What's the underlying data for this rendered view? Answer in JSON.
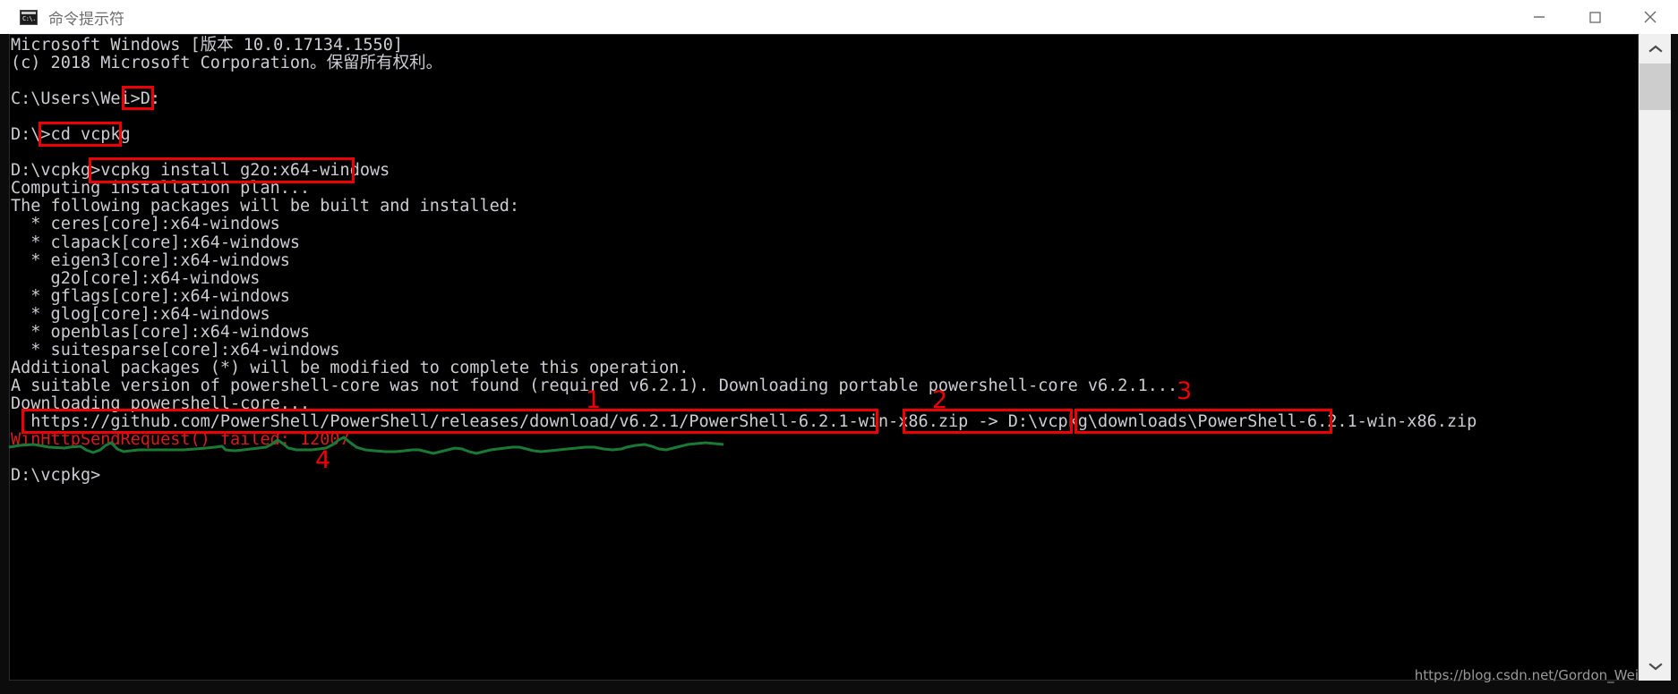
{
  "window": {
    "title": "命令提示符",
    "icon": "command-prompt-icon",
    "icon_text": "C:\\.",
    "controls": {
      "minimize": "minimize-icon",
      "maximize": "maximize-icon",
      "close": "close-icon"
    }
  },
  "colors": {
    "console_bg": "#000000",
    "console_fg": "#ccccd2",
    "error_fg": "#d81c1c",
    "annotation_red": "#ee0000",
    "annotation_green": "#1a7a35",
    "titlebar_bg": "#ffffff",
    "title_fg": "#6e6e6e"
  },
  "console": {
    "lines": [
      {
        "text": "Microsoft Windows [版本 10.0.17134.1550]",
        "error": false
      },
      {
        "text": "(c) 2018 Microsoft Corporation。保留所有权利。",
        "error": false
      },
      {
        "text": "",
        "error": false
      },
      {
        "text": "C:\\Users\\Wei>D:",
        "error": false
      },
      {
        "text": "",
        "error": false
      },
      {
        "text": "D:\\>cd vcpkg",
        "error": false
      },
      {
        "text": "",
        "error": false
      },
      {
        "text": "D:\\vcpkg>vcpkg install g2o:x64-windows",
        "error": false
      },
      {
        "text": "Computing installation plan...",
        "error": false
      },
      {
        "text": "The following packages will be built and installed:",
        "error": false
      },
      {
        "text": "  * ceres[core]:x64-windows",
        "error": false
      },
      {
        "text": "  * clapack[core]:x64-windows",
        "error": false
      },
      {
        "text": "  * eigen3[core]:x64-windows",
        "error": false
      },
      {
        "text": "    g2o[core]:x64-windows",
        "error": false
      },
      {
        "text": "  * gflags[core]:x64-windows",
        "error": false
      },
      {
        "text": "  * glog[core]:x64-windows",
        "error": false
      },
      {
        "text": "  * openblas[core]:x64-windows",
        "error": false
      },
      {
        "text": "  * suitesparse[core]:x64-windows",
        "error": false
      },
      {
        "text": "Additional packages (*) will be modified to complete this operation.",
        "error": false
      },
      {
        "text": "A suitable version of powershell-core was not found (required v6.2.1). Downloading portable powershell-core v6.2.1...",
        "error": false
      },
      {
        "text": "Downloading powershell-core...",
        "error": false
      },
      {
        "text": "  https://github.com/PowerShell/PowerShell/releases/download/v6.2.1/PowerShell-6.2.1-win-x86.zip -> D:\\vcpkg\\downloads\\PowerShell-6.2.1-win-x86.zip",
        "error": false
      },
      {
        "text": "WinHttpSendRequest() failed: 12007",
        "error": true
      },
      {
        "text": "",
        "error": false
      },
      {
        "text": "D:\\vcpkg>",
        "error": false
      }
    ]
  },
  "annotations": {
    "boxes": [
      {
        "name": "highlight-drive-change",
        "target": "D:"
      },
      {
        "name": "highlight-cd-command",
        "target": "cd vcpkg"
      },
      {
        "name": "highlight-install-command",
        "target": "vcpkg install g2o:x64-windows"
      },
      {
        "name": "highlight-download-url",
        "target": "https://github.com/PowerShell/PowerShell/releases/download/v6.2.1/PowerShell-6.2.1-win-x86.zip"
      },
      {
        "name": "highlight-downloads-dir",
        "target": "D:\\vcpkg\\downloads"
      },
      {
        "name": "highlight-zip-filename",
        "target": "PowerShell-6.2.1-win-x86.zip"
      }
    ],
    "markers": [
      {
        "label": "1",
        "refers_to": "required v6.2.1"
      },
      {
        "label": "2",
        "refers_to": "D:\\vcpkg\\downloads"
      },
      {
        "label": "3",
        "refers_to": "PowerShell-6.2.1-win-x86.zip"
      },
      {
        "label": "4",
        "refers_to": "WinHttpSendRequest() failed: 12007"
      }
    ],
    "underline": {
      "name": "error-squiggle-underline",
      "color": "#1a7a35"
    }
  },
  "scrollbar": {
    "up_arrow": "chevron-up-icon",
    "down_arrow": "chevron-down-icon"
  },
  "watermark": {
    "text": "https://blog.csdn.net/Gordon_Wei"
  }
}
